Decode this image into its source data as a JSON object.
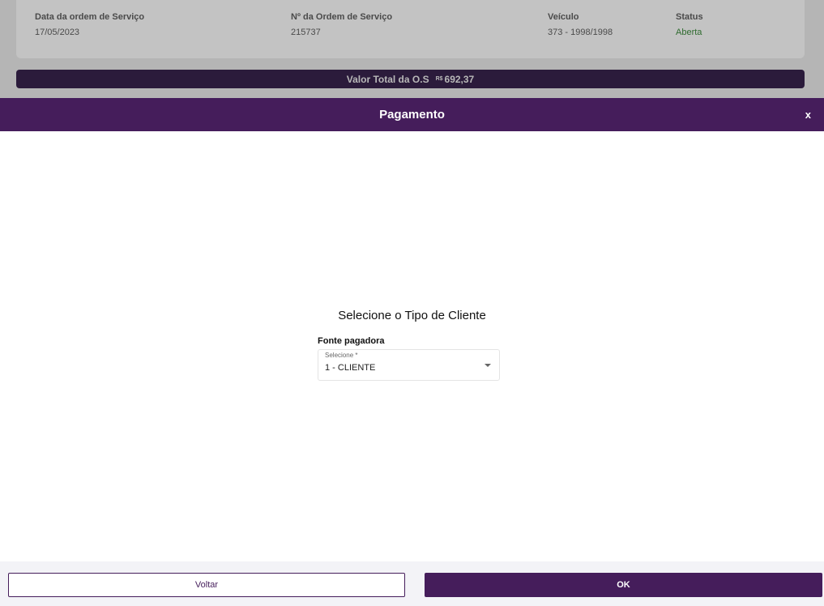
{
  "order_info": {
    "date_label": "Data da ordem de Serviço",
    "date_value": "17/05/2023",
    "number_label": "Nº da Ordem de Serviço",
    "number_value": "215737",
    "vehicle_label": "Veículo",
    "vehicle_value": "373 - 1998/1998",
    "status_label": "Status",
    "status_value": "Aberta"
  },
  "total": {
    "label": "Valor Total da O.S",
    "currency": "R$",
    "value": "692,37"
  },
  "modal": {
    "title": "Pagamento",
    "close_label": "x",
    "section_title": "Selecione o Tipo de Cliente",
    "field_label": "Fonte pagadora",
    "select_floating_label": "Selecione *",
    "select_value": "1 - CLIENTE"
  },
  "footer": {
    "back_label": "Voltar",
    "ok_label": "OK"
  },
  "colors": {
    "primary": "#451d5b",
    "total_bar": "#2b1b3b",
    "status_open": "#2f6b2f"
  },
  "icons": {
    "select_arrow": "chevron-down-icon"
  }
}
